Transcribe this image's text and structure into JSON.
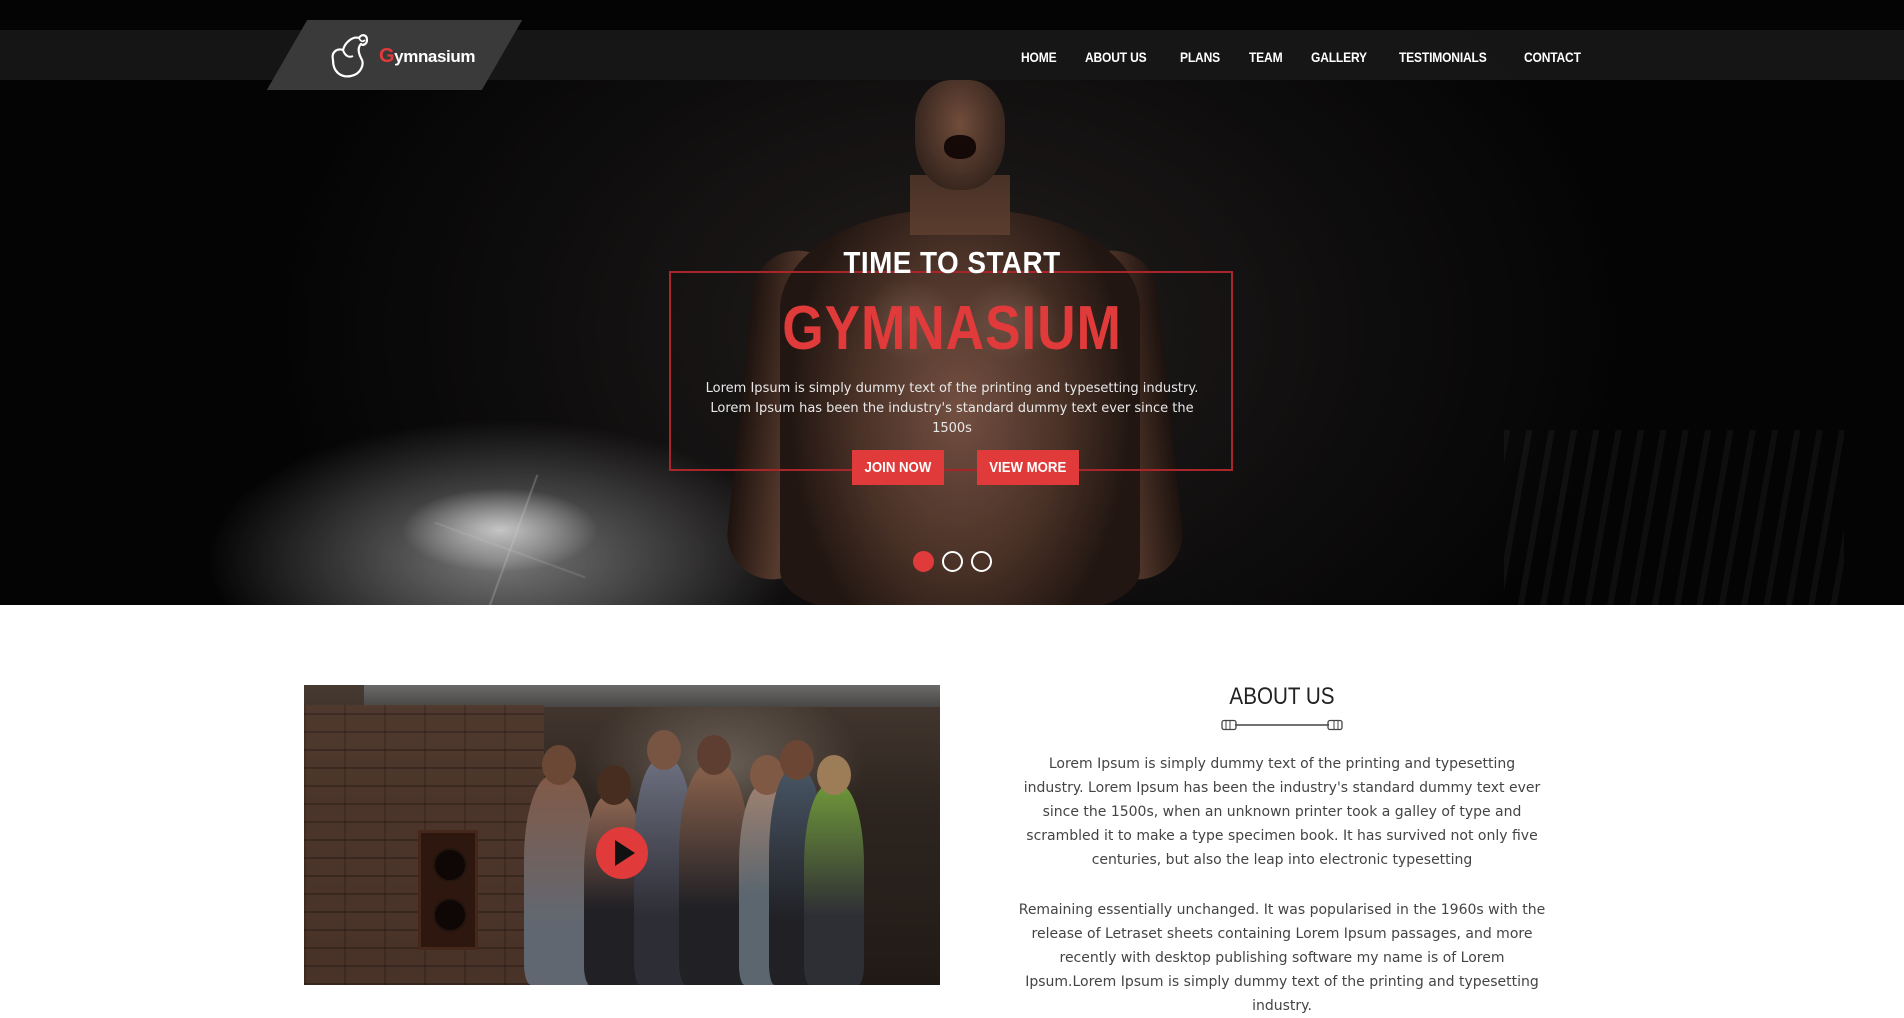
{
  "logo": {
    "text_first": "G",
    "text_rest": "ymnasium"
  },
  "nav": {
    "items": [
      "HOME",
      "ABOUT US",
      "PLANS",
      "TEAM",
      "GALLERY",
      "TESTIMONIALS",
      "CONTACT"
    ]
  },
  "hero": {
    "pre_title": "TIME TO START",
    "title": "GYMNASIUM",
    "description": "Lorem Ipsum is simply dummy text of the printing and typesetting industry. Lorem Ipsum has been the industry's standard dummy text ever since the 1500s",
    "join_label": "JOIN NOW",
    "view_label": "VIEW MORE",
    "slides": {
      "count": 3,
      "active": 1
    },
    "accent_color": "#e03a3a",
    "frame_color": "#a8252a"
  },
  "about": {
    "title": "ABOUT US",
    "paragraph1": "Lorem Ipsum is simply dummy text of the printing and typesetting industry. Lorem Ipsum has been the industry's standard dummy text ever since the 1500s, when an unknown printer took a galley of type and scrambled it to make a type specimen book. It has survived not only five centuries, but also the leap into electronic typesetting",
    "paragraph2": "Remaining essentially unchanged. It was popularised in the 1960s with the release of Letraset sheets containing Lorem Ipsum passages, and more recently with desktop publishing software my name is of Lorem Ipsum.Lorem Ipsum is simply dummy text of the printing and typesetting industry.",
    "video_icon": "play-icon",
    "divider_icon": "barbell-icon"
  }
}
